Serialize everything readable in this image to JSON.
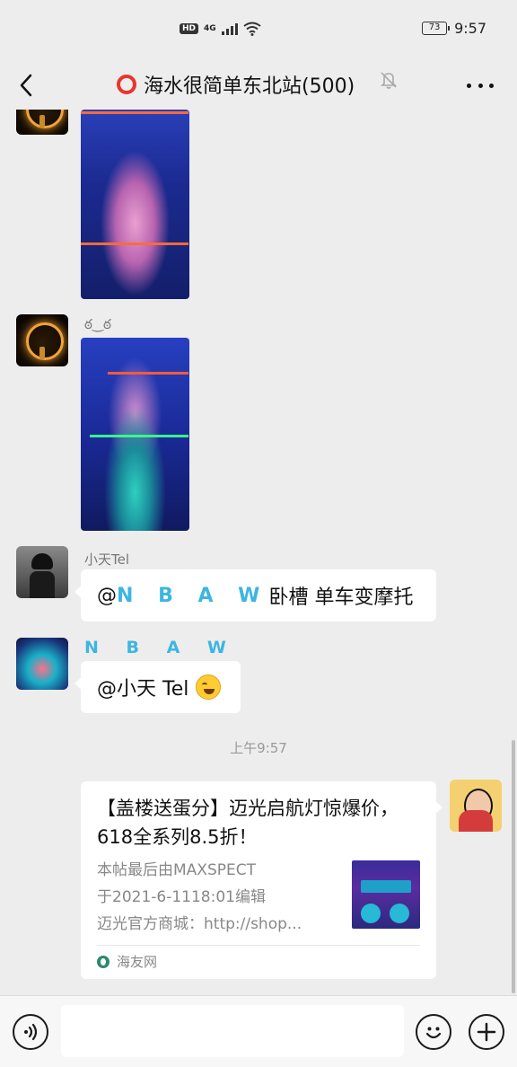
{
  "status_bar": {
    "hd": "HD",
    "network": "4G",
    "battery": "73",
    "time": "9:57"
  },
  "header": {
    "title": "海水很简单东北站(500)",
    "icons": [
      "back-arrow-icon",
      "mute-bell-icon",
      "more-icon"
    ]
  },
  "messages": [
    {
      "type": "image",
      "sender_name": ""
    },
    {
      "type": "image",
      "sender_name": "ఠ‿ఠ"
    },
    {
      "type": "text",
      "sender_name": "小天Tel",
      "mention": "@",
      "mention_name": "N B A W",
      "text": " 卧槽 单车变摩托"
    },
    {
      "type": "text",
      "sender_name": "N B A W",
      "mention": "@小天 Tel",
      "emoji": "laughing-tears-emoji"
    }
  ],
  "timestamp": "上午9:57",
  "share_card": {
    "title": "【盖楼送蛋分】迈光启航灯惊爆价，618全系列8.5折！",
    "desc_lines": [
      "本帖最后由MAXSPECT",
      "于2021-6-1118:01编辑",
      "迈光官方商城：http://shop..."
    ],
    "source": "海友网"
  },
  "input_bar": {
    "placeholder": "",
    "icons": [
      "voice-icon",
      "emoji-icon",
      "plus-icon"
    ]
  }
}
